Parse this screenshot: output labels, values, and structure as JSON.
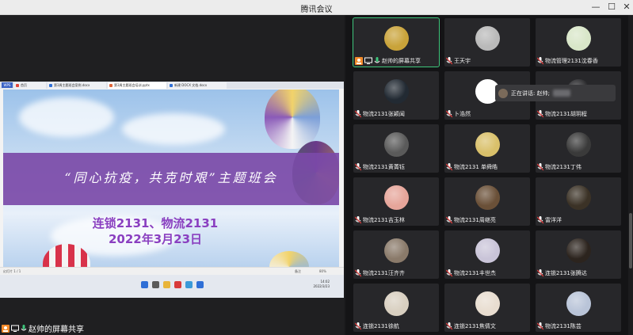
{
  "window": {
    "title": "腾讯会议",
    "minimize": "—",
    "maximize": "☐",
    "close": "✕"
  },
  "share": {
    "label": "赵帅的屏幕共享",
    "tabs": [
      "首页",
      "第3周主题班会案例.docx",
      "第3周主题班会培训.pptx",
      "新建 DOCX 文档.docx"
    ],
    "app_button": "WPS",
    "status_left": "幻灯片 1 / 1",
    "status_mid": "备注",
    "zoom": "80%",
    "clock_time": "14:02",
    "clock_date": "2022/3/23",
    "slide": {
      "banner": "“同心抗疫，共克时艰”主题班会",
      "line1": "连锁2131、物流2131",
      "line2": "2022年3月23日"
    }
  },
  "speaking": {
    "label": "正在讲话: 赵帅;"
  },
  "participants": [
    {
      "name": "赵帅的屏幕共享",
      "avatar_color": "#c9a33a",
      "active": true,
      "share": true
    },
    {
      "name": "王天宇",
      "avatar_color": "#b9b9b9"
    },
    {
      "name": "物流管理2131沈春香",
      "avatar_color": "#d8e6c8"
    },
    {
      "name": "物流2131张颖闻",
      "avatar_color": "#222a33"
    },
    {
      "name": "卜浩然",
      "avatar_color": "#ffffff"
    },
    {
      "name": "物流2131胡玥程",
      "avatar_color": "#27272a"
    },
    {
      "name": "物流2131黄菁钰",
      "avatar_color": "#5a5a5a"
    },
    {
      "name": "物流2131 单舜皓",
      "avatar_color": "#d9c06a"
    },
    {
      "name": "物流2131丁伟",
      "avatar_color": "#3a3a3a"
    },
    {
      "name": "物流2131吉玉林",
      "avatar_color": "#e6a59a"
    },
    {
      "name": "物流2131周继亮",
      "avatar_color": "#6a5038"
    },
    {
      "name": "雷洋洋",
      "avatar_color": "#3b3226"
    },
    {
      "name": "物流2131汪齐齐",
      "avatar_color": "#8a7a6a"
    },
    {
      "name": "物流2131丰世杰",
      "avatar_color": "#c9c4d8"
    },
    {
      "name": "连锁2131张腾达",
      "avatar_color": "#2c241e"
    },
    {
      "name": "连锁2131徐航",
      "avatar_color": "#d8cfc0"
    },
    {
      "name": "连锁2131焦倩文",
      "avatar_color": "#e8ddd0"
    },
    {
      "name": "物流2131陈芸",
      "avatar_color": "#b9c4d8"
    }
  ]
}
